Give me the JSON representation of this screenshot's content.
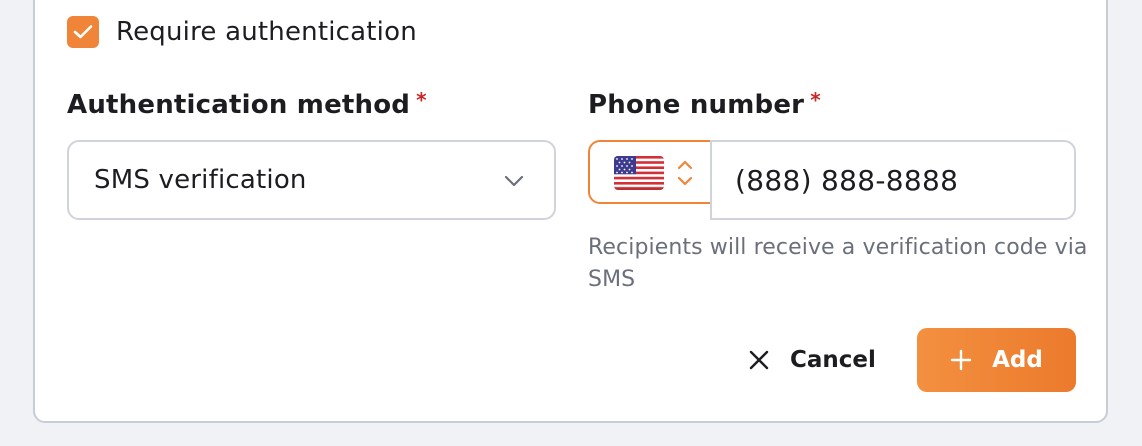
{
  "auth_toggle": {
    "label": "Require authentication",
    "checked": true
  },
  "auth_method": {
    "label": "Authentication method",
    "required_mark": "*",
    "selected_value": "SMS verification",
    "icon": "chevron-down-icon"
  },
  "phone": {
    "label": "Phone number",
    "required_mark": "*",
    "country_icon": "us-flag-icon",
    "selector_icon": "chevron-up-down-icon",
    "value": "(888) 888-8888",
    "helper_text": "Recipients will receive a verification code via SMS"
  },
  "actions": {
    "cancel_label": "Cancel",
    "cancel_icon": "close-icon",
    "add_label": "Add",
    "add_icon": "plus-icon"
  },
  "colors": {
    "accent": "#f0853a",
    "required": "#c62828",
    "helper_text": "#6b6f7b",
    "border": "#d0d3db",
    "background": "#f1f2f6"
  }
}
